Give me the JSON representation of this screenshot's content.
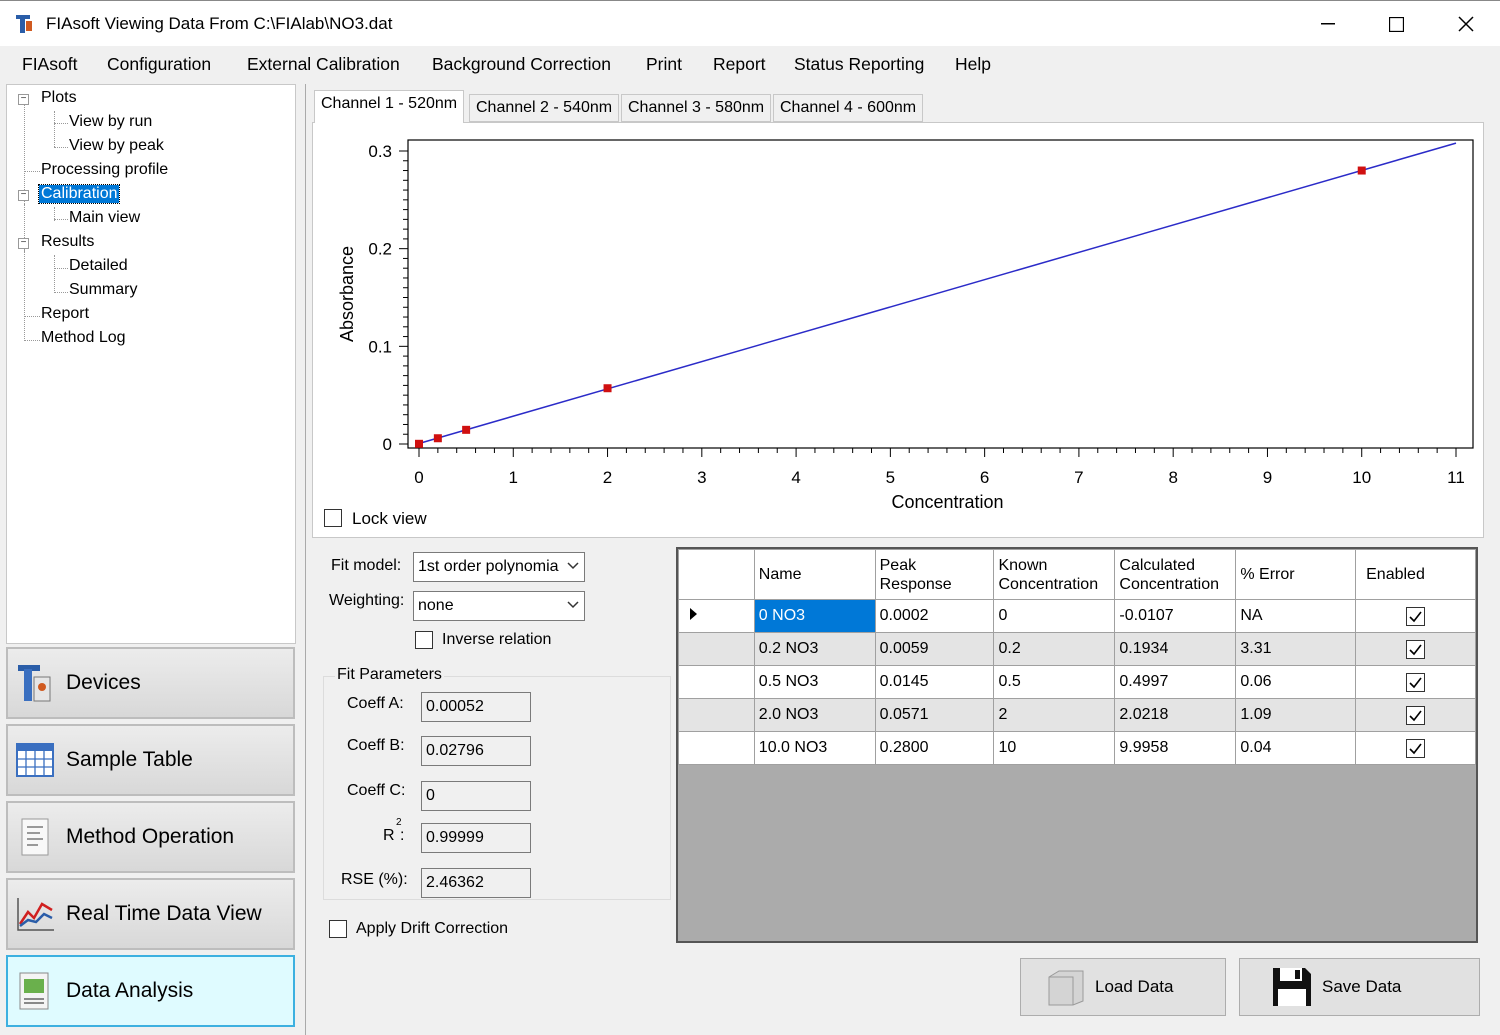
{
  "window": {
    "title": "FIAsoft Viewing Data From C:\\FIAlab\\NO3.dat"
  },
  "menu": [
    "FIAsoft",
    "Configuration",
    "External Calibration",
    "Background Correction",
    "Print",
    "Report",
    "Status Reporting",
    "Help"
  ],
  "tree": {
    "plots": "Plots",
    "view_by_run": "View by run",
    "view_by_peak": "View by peak",
    "processing_profile": "Processing profile",
    "calibration": "Calibration",
    "main_view": "Main view",
    "results": "Results",
    "detailed": "Detailed",
    "summary": "Summary",
    "report": "Report",
    "method_log": "Method Log"
  },
  "nav": [
    "Devices",
    "Sample Table",
    "Method Operation",
    "Real Time Data View",
    "Data Analysis"
  ],
  "tabs": [
    "Channel 1 - 520nm",
    "Channel 2 - 540nm",
    "Channel 3 - 580nm",
    "Channel 4 - 600nm"
  ],
  "lock_view": "Lock view",
  "fit": {
    "model_label": "Fit model:",
    "model_value": "1st order polynomia",
    "weighting_label": "Weighting:",
    "weighting_value": "none",
    "inverse_label": "Inverse relation",
    "params_title": "Fit Parameters",
    "coeff_a_label": "Coeff A:",
    "coeff_a": "0.00052",
    "coeff_b_label": "Coeff B:",
    "coeff_b": "0.02796",
    "coeff_c_label": "Coeff C:",
    "coeff_c": "0",
    "r2_label": "R",
    "r2_sup": "2",
    "r2_colon": ":",
    "r2": "0.99999",
    "rse_label": "RSE (%):",
    "rse": "2.46362",
    "drift_label": "Apply Drift Correction"
  },
  "grid": {
    "headers": {
      "name": "Name",
      "peak1": "Peak",
      "peak2": "Response",
      "known1": "Known",
      "known2": "Concentration",
      "calc1": "Calculated",
      "calc2": "Concentration",
      "error": "% Error",
      "enabled": "Enabled"
    },
    "rows": [
      {
        "name": "0 NO3",
        "peak": "0.0002",
        "known": "0",
        "calc": "-0.0107",
        "err": "NA"
      },
      {
        "name": "0.2 NO3",
        "peak": "0.0059",
        "known": "0.2",
        "calc": "0.1934",
        "err": "3.31"
      },
      {
        "name": "0.5 NO3",
        "peak": "0.0145",
        "known": "0.5",
        "calc": "0.4997",
        "err": "0.06"
      },
      {
        "name": "2.0 NO3",
        "peak": "0.0571",
        "known": "2",
        "calc": "2.0218",
        "err": "1.09"
      },
      {
        "name": "10.0 NO3",
        "peak": "0.2800",
        "known": "10",
        "calc": "9.9958",
        "err": "0.04"
      }
    ]
  },
  "buttons": {
    "load": "Load Data",
    "save": "Save Data"
  },
  "colors": {
    "line": "#2b2bc8",
    "point": "#d01010",
    "accent": "#0078d7"
  },
  "chart_data": {
    "type": "scatter",
    "xlabel": "Concentration",
    "ylabel": "Absorbance",
    "xlim": [
      0,
      11
    ],
    "ylim": [
      0,
      0.3
    ],
    "xticks": [
      0,
      1,
      2,
      3,
      4,
      5,
      6,
      7,
      8,
      9,
      10,
      11
    ],
    "yticks": [
      0,
      0.1,
      0.2,
      0.3
    ],
    "ytick_labels": [
      "0",
      "0.1",
      "0.2",
      "0.3"
    ],
    "points": {
      "x": [
        0,
        0.2,
        0.5,
        2,
        10
      ],
      "y": [
        0.0002,
        0.0059,
        0.0145,
        0.0571,
        0.28
      ]
    },
    "fit_line": {
      "x": [
        0,
        11
      ],
      "y": [
        0.00052,
        0.30808
      ]
    },
    "grid": false
  }
}
